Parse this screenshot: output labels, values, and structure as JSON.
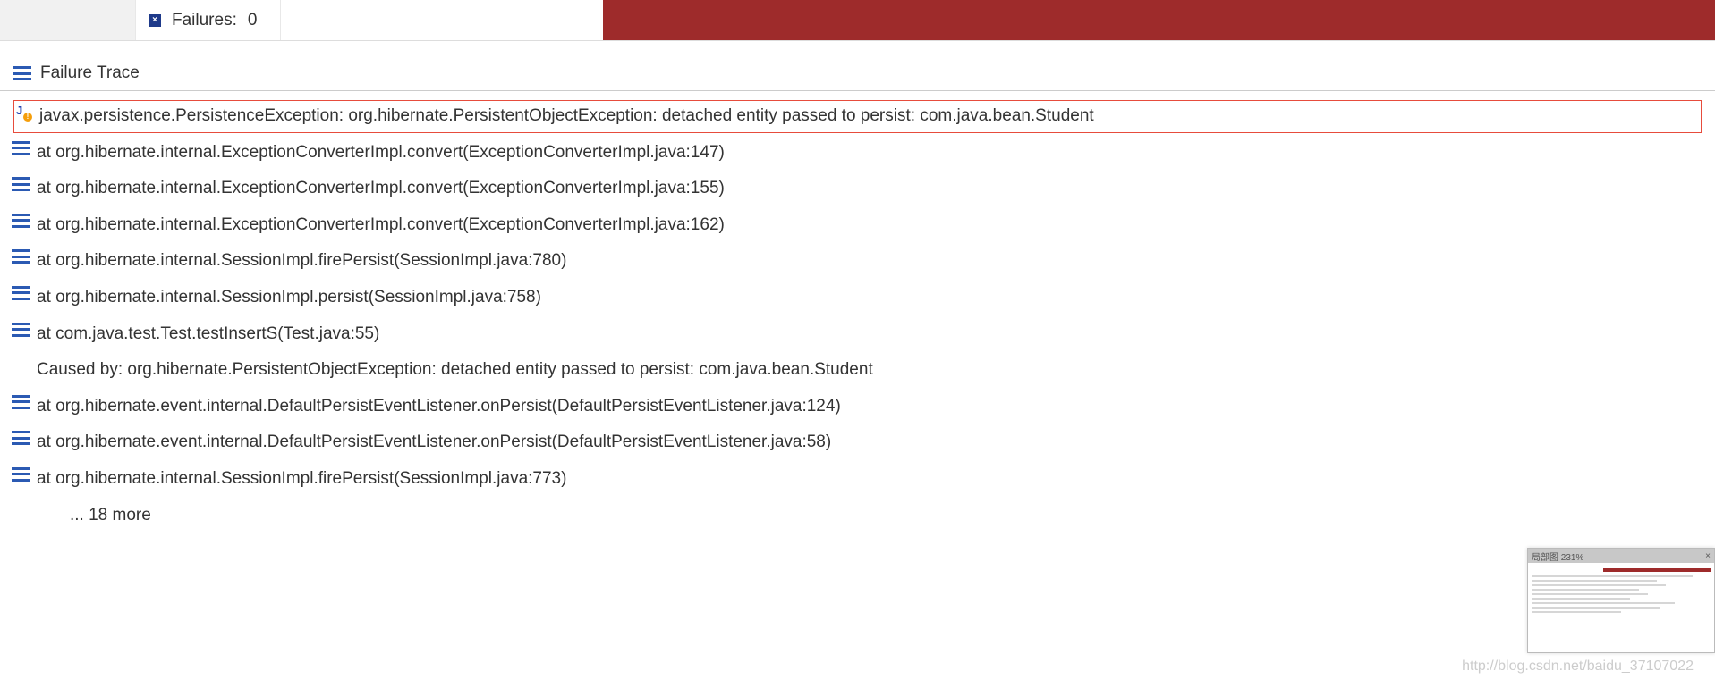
{
  "header": {
    "failures_label": "Failures:",
    "failures_value": "0"
  },
  "section": {
    "title": "Failure Trace"
  },
  "trace": [
    {
      "icon": "warn",
      "highlight": true,
      "text": "javax.persistence.PersistenceException: org.hibernate.PersistentObjectException: detached entity passed to persist: com.java.bean.Student"
    },
    {
      "icon": "stack",
      "text": "at org.hibernate.internal.ExceptionConverterImpl.convert(ExceptionConverterImpl.java:147)"
    },
    {
      "icon": "stack",
      "text": "at org.hibernate.internal.ExceptionConverterImpl.convert(ExceptionConverterImpl.java:155)"
    },
    {
      "icon": "stack",
      "text": "at org.hibernate.internal.ExceptionConverterImpl.convert(ExceptionConverterImpl.java:162)"
    },
    {
      "icon": "stack",
      "text": "at org.hibernate.internal.SessionImpl.firePersist(SessionImpl.java:780)"
    },
    {
      "icon": "stack",
      "text": "at org.hibernate.internal.SessionImpl.persist(SessionImpl.java:758)"
    },
    {
      "icon": "stack",
      "text": "at com.java.test.Test.testInsertS(Test.java:55)"
    },
    {
      "icon": "none",
      "noicon": true,
      "text": "Caused by: org.hibernate.PersistentObjectException: detached entity passed to persist: com.java.bean.Student"
    },
    {
      "icon": "stack",
      "text": "at org.hibernate.event.internal.DefaultPersistEventListener.onPersist(DefaultPersistEventListener.java:124)"
    },
    {
      "icon": "stack",
      "text": "at org.hibernate.event.internal.DefaultPersistEventListener.onPersist(DefaultPersistEventListener.java:58)"
    },
    {
      "icon": "stack",
      "text": "at org.hibernate.internal.SessionImpl.firePersist(SessionImpl.java:773)"
    },
    {
      "icon": "none",
      "indent": true,
      "text": "... 18 more"
    }
  ],
  "thumb": {
    "title": "局部图 231%"
  },
  "watermark": "http://blog.csdn.net/baidu_37107022"
}
